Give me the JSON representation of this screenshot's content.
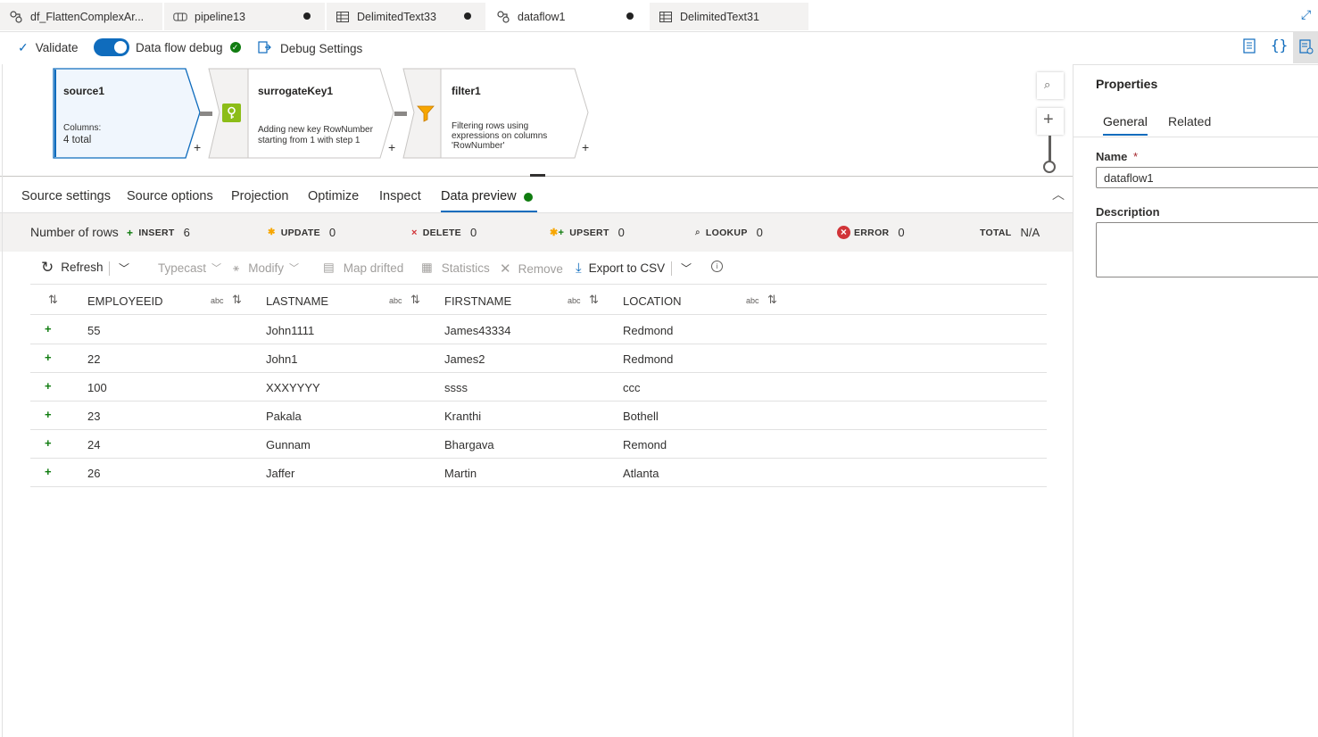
{
  "tabs": [
    {
      "label": "df_FlattenComplexAr...",
      "icon": "dataflow-icon",
      "dirty": false,
      "active": false
    },
    {
      "label": "pipeline13",
      "icon": "pipeline-icon",
      "dirty": true,
      "active": false
    },
    {
      "label": "DelimitedText33",
      "icon": "table-icon",
      "dirty": true,
      "active": false
    },
    {
      "label": "dataflow1",
      "icon": "dataflow-icon",
      "dirty": true,
      "active": true
    },
    {
      "label": "DelimitedText31",
      "icon": "table-icon",
      "dirty": false,
      "active": false
    }
  ],
  "toolbar": {
    "validate": "Validate",
    "debug": "Data flow debug",
    "debug_settings": "Debug Settings"
  },
  "nodes": {
    "source": {
      "title": "source1",
      "sub1": "Columns:",
      "sub2": "4 total"
    },
    "surrogate": {
      "title": "surrogateKey1",
      "sub1": "Adding new key RowNumber",
      "sub2": "starting from 1 with step 1"
    },
    "filter": {
      "title": "filter1",
      "sub1": "Filtering rows using",
      "sub2": "expressions on columns",
      "sub3": "'RowNumber'"
    }
  },
  "panel_tabs": [
    "Source settings",
    "Source options",
    "Projection",
    "Optimize",
    "Inspect",
    "Data preview"
  ],
  "stats": {
    "label": "Number of rows",
    "insert": {
      "label": "INSERT",
      "value": "6"
    },
    "update": {
      "label": "UPDATE",
      "value": "0"
    },
    "delete": {
      "label": "DELETE",
      "value": "0"
    },
    "upsert": {
      "label": "UPSERT",
      "value": "0"
    },
    "lookup": {
      "label": "LOOKUP",
      "value": "0"
    },
    "error": {
      "label": "ERROR",
      "value": "0"
    },
    "total": {
      "label": "TOTAL",
      "value": "N/A"
    }
  },
  "grid_toolbar": {
    "refresh": "Refresh",
    "typecast": "Typecast",
    "modify": "Modify",
    "map_drifted": "Map drifted",
    "statistics": "Statistics",
    "remove": "Remove",
    "export": "Export to CSV"
  },
  "table": {
    "type_label": "abc",
    "columns": [
      "EMPLOYEEID",
      "LASTNAME",
      "FIRSTNAME",
      "LOCATION"
    ],
    "rows": [
      [
        "55",
        "John1111",
        "James43334",
        "Redmond"
      ],
      [
        "22",
        "John1",
        "James2",
        "Redmond"
      ],
      [
        "100",
        "XXXYYYY",
        "ssss",
        "ccc"
      ],
      [
        "23",
        "Pakala",
        "Kranthi",
        "Bothell"
      ],
      [
        "24",
        "Gunnam",
        "Bhargava",
        "Remond"
      ],
      [
        "26",
        "Jaffer",
        "Martin",
        "Atlanta"
      ]
    ]
  },
  "properties": {
    "title": "Properties",
    "tabs": [
      "General",
      "Related"
    ],
    "name_label": "Name",
    "required_mark": "*",
    "name_value": "dataflow1",
    "description_label": "Description",
    "description_value": ""
  },
  "colors": {
    "accent": "#0f6cbd",
    "success": "#107c10",
    "error": "#d13438",
    "warning": "#f7a600"
  }
}
